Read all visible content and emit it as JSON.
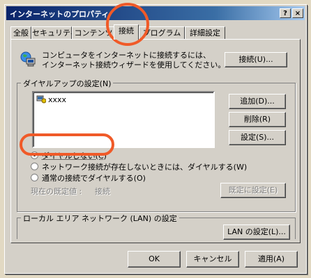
{
  "window": {
    "title": "インターネットのプロパティ",
    "help_btn": "?",
    "close_btn": "×"
  },
  "tabs": [
    {
      "label": "全般"
    },
    {
      "label": "セキュリティ"
    },
    {
      "label": "コンテンツ"
    },
    {
      "label": "接続"
    },
    {
      "label": "プログラム"
    },
    {
      "label": "詳細設定"
    }
  ],
  "setup": {
    "text1": "コンピュータをインターネットに接続するには、",
    "text2": "インターネット接続ウィザードを使用してください。",
    "button": "接続(U)..."
  },
  "dialup": {
    "group_title": "ダイヤルアップの設定(N)",
    "list_item": "xxxx",
    "add_button": "追加(D)...",
    "remove_button": "削除(R)",
    "settings_button": "設定(S)...",
    "radio1": "ダイヤルしない(C)",
    "radio2": "ネットワーク接続が存在しないときには、ダイヤルする(W)",
    "radio3": "通常の接続でダイヤルする(O)",
    "current_default_label": "現在の既定値 :",
    "current_default_value": "接続",
    "set_default_button": "既定に設定(E)"
  },
  "lan": {
    "group_title": "ローカル エリア ネットワーク (LAN) の設定",
    "button": "LAN の設定(L)..."
  },
  "footer": {
    "ok": "OK",
    "cancel": "キャンセル",
    "apply": "適用(A)"
  },
  "colors": {
    "highlight_ring": "#f05a28",
    "titlebar": "#0a246a"
  }
}
